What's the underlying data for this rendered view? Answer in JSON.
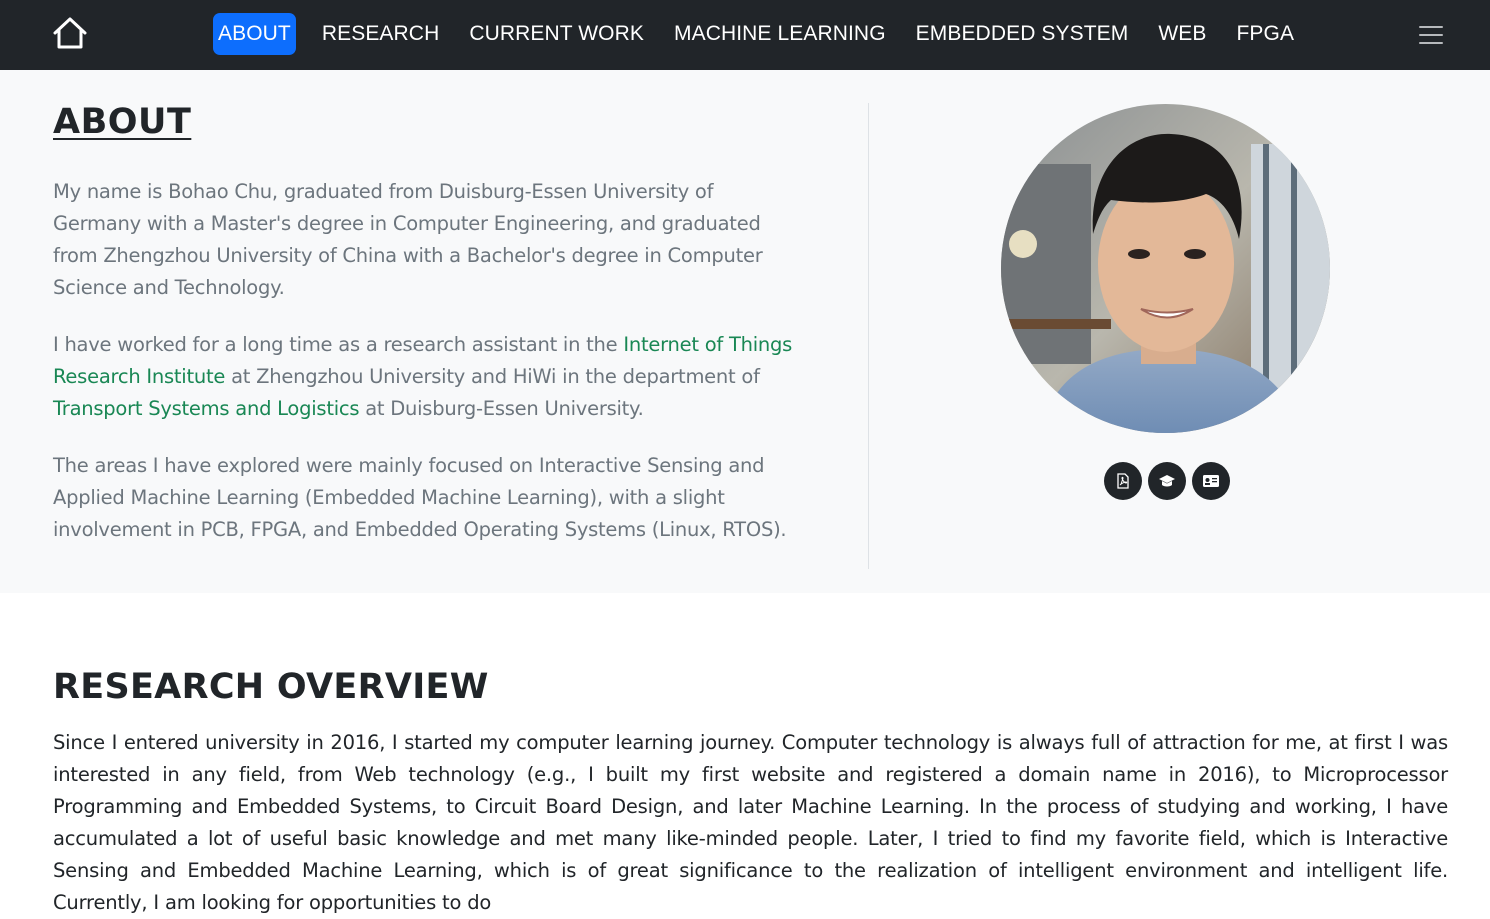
{
  "nav": {
    "home_icon": "home-icon",
    "items": [
      {
        "label": "ABOUT",
        "active": true
      },
      {
        "label": "RESEARCH",
        "active": false
      },
      {
        "label": "CURRENT WORK",
        "active": false
      },
      {
        "label": "MACHINE LEARNING",
        "active": false
      },
      {
        "label": "EMBEDDED SYSTEM",
        "active": false
      },
      {
        "label": "WEB",
        "active": false
      },
      {
        "label": "FPGA",
        "active": false
      }
    ],
    "menu_icon": "hamburger-menu-icon"
  },
  "about": {
    "title": "ABOUT",
    "p1": "My name is Bohao Chu, graduated from Duisburg-Essen University of Germany with a Master's degree in Computer Engineering, and graduated from Zhengzhou University of China with a Bachelor's degree in Computer Science and Technology.",
    "p2_before": "I have worked for a long time as a research assistant in the ",
    "p2_link1": "Internet of Things Research Institute",
    "p2_middle": " at Zhengzhou University and HiWi in the department of ",
    "p2_link2": "Transport Systems and Logistics",
    "p2_after": " at Duisburg-Essen University.",
    "p3": "The areas I have explored were mainly focused on Interactive Sensing and Applied Machine Learning (Embedded Machine Learning), with a slight involvement in PCB, FPGA, and Embedded Operating Systems (Linux, RTOS).",
    "social_icons": [
      "pdf-icon",
      "graduation-cap-icon",
      "id-card-icon"
    ]
  },
  "research": {
    "title": "RESEARCH OVERVIEW",
    "text": "Since I entered university in 2016, I started my computer learning journey. Computer technology is always full of attraction for me, at first I was interested in any field, from Web technology (e.g., I built my first website and registered a domain name in 2016), to Microprocessor Programming and Embedded Systems, to Circuit Board Design, and later Machine Learning. In the process of studying and working, I have accumulated a lot of useful basic knowledge and met many like-minded people. Later, I tried to find my favorite field, which is Interactive Sensing and Embedded Machine Learning, which is of great significance to the realization of intelligent environment and intelligent life. Currently, I am looking for opportunities to do"
  },
  "colors": {
    "navbar_bg": "#212529",
    "active_nav_bg": "#0d6efd",
    "link_green": "#198754",
    "muted_text": "#6c757d",
    "section_bg": "#f8f9fa"
  }
}
